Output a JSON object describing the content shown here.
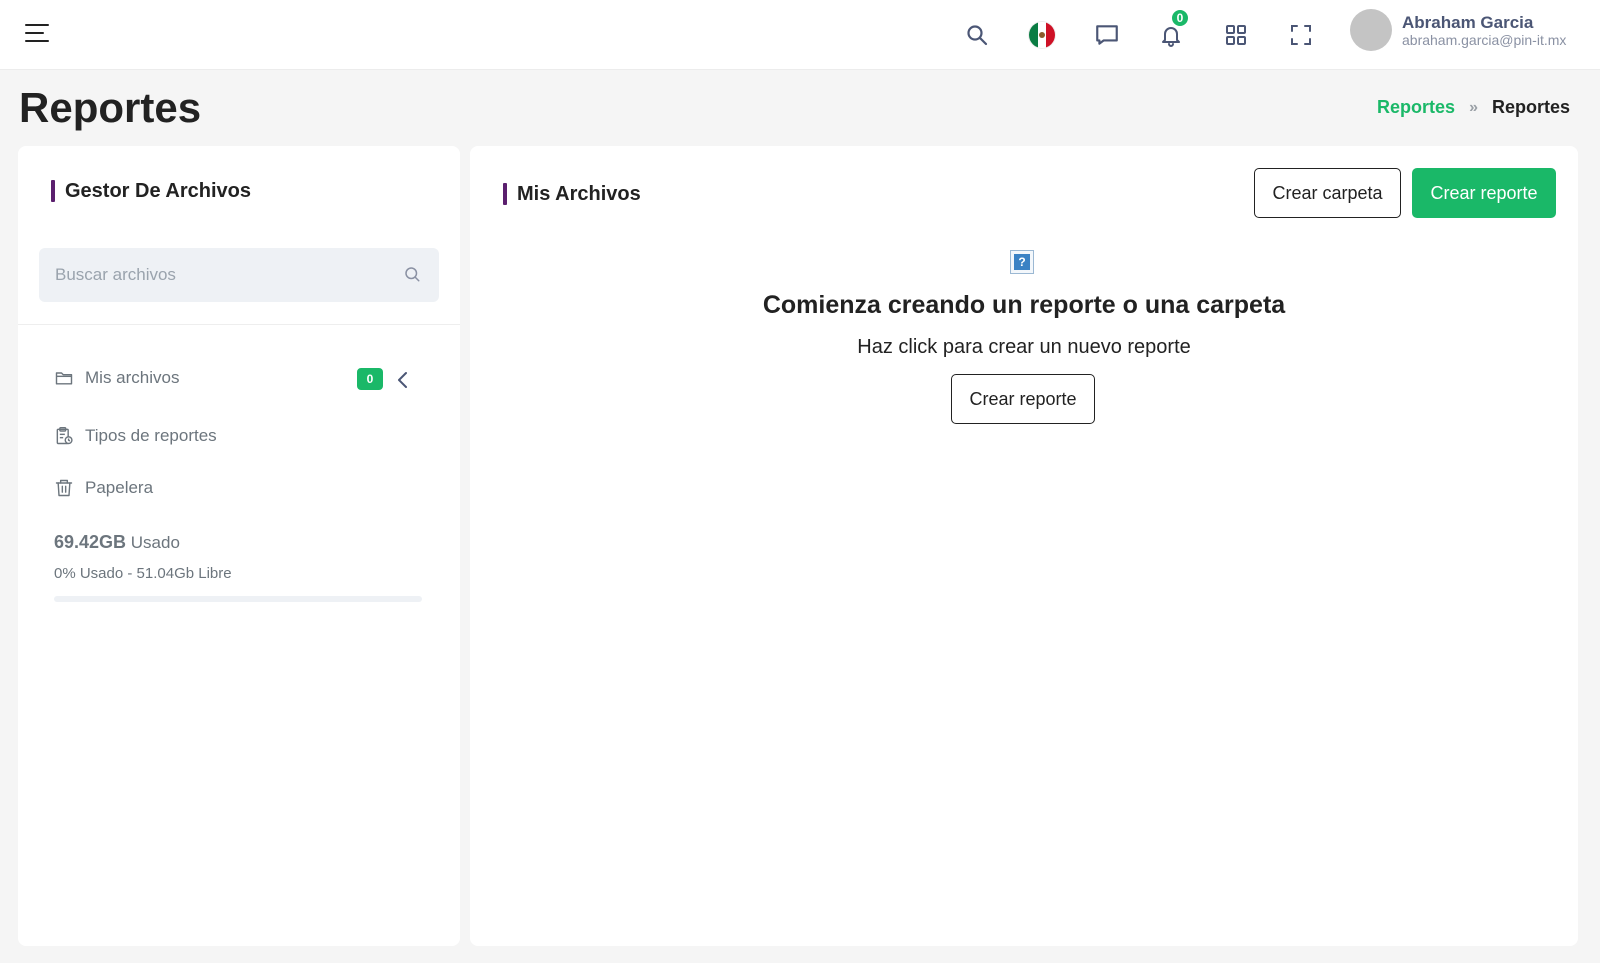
{
  "header": {
    "user": {
      "name": "Abraham Garcia",
      "email": "abraham.garcia@pin-it.mx"
    },
    "notifications_count": "0",
    "icons": [
      "menu-icon",
      "search-icon",
      "mexico-flag-icon",
      "chat-icon",
      "bell-icon",
      "apps-grid-icon",
      "fullscreen-icon"
    ]
  },
  "page": {
    "title": "Reportes",
    "breadcrumb": {
      "parent": "Reportes",
      "separator": "»",
      "current": "Reportes"
    }
  },
  "file_manager": {
    "title": "Gestor De Archivos",
    "search_placeholder": "Buscar archivos",
    "items": [
      {
        "label": "Mis archivos",
        "icon": "folder-icon",
        "badge": "0"
      },
      {
        "label": "Tipos de reportes",
        "icon": "clipboard-clock-icon"
      },
      {
        "label": "Papelera",
        "icon": "trash-icon"
      }
    ],
    "storage": {
      "used_amount": "69.42GB",
      "used_label": "Usado",
      "summary": "0% Usado - 51.04Gb Libre",
      "used_fraction": 0
    }
  },
  "my_files": {
    "title": "Mis Archivos",
    "create_folder_label": "Crear carpeta",
    "create_report_label": "Crear reporte",
    "empty": {
      "icon": "question-icon",
      "icon_text": "?",
      "title": "Comienza creando un reporte o una carpeta",
      "subtitle": "Haz click para crear un nuevo reporte",
      "button_label": "Crear reporte"
    }
  },
  "colors": {
    "accent": "#1ab868",
    "title_bar": "#5b1f6e",
    "user_name": "#4b5675"
  }
}
